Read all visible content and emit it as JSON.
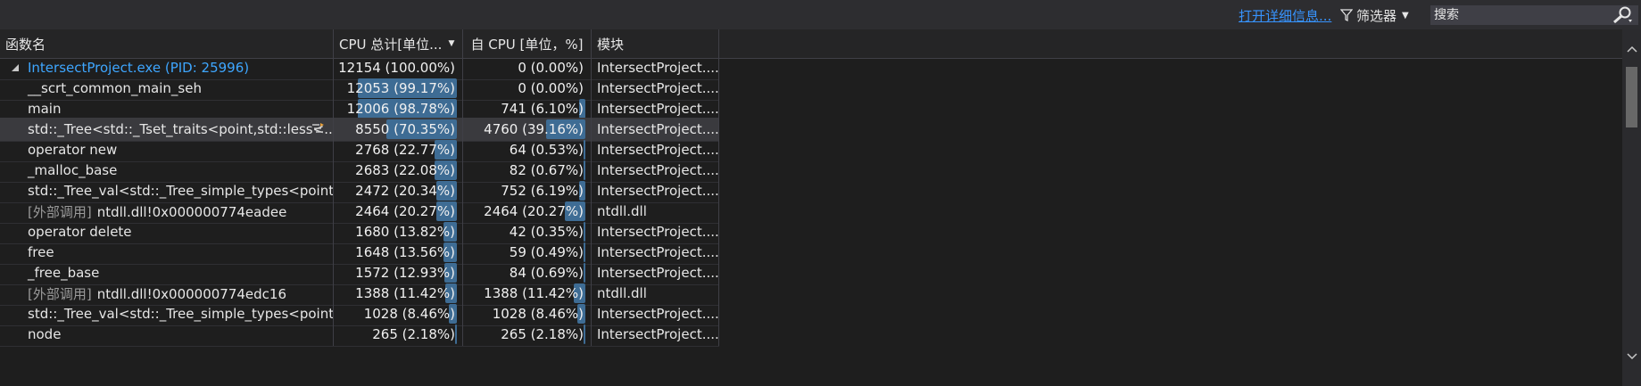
{
  "toolbar": {
    "details_link": "打开详细信息...",
    "filter_label": "筛选器",
    "search_placeholder": "搜索"
  },
  "columns": {
    "name": "函数名",
    "total_cpu": "CPU 总计[单位...",
    "self_cpu": "自 CPU [单位，%]",
    "module": "模块"
  },
  "rows": [
    {
      "name": "IntersectProject.exe (PID: 25996)",
      "root": true,
      "total": "12154 (100.00%)",
      "total_pct": 0,
      "self": "0 (0.00%)",
      "self_pct": 0,
      "module": "IntersectProject...."
    },
    {
      "name": "__scrt_common_main_seh",
      "total": "12053 (99.17%)",
      "total_pct": 99.17,
      "self": "0 (0.00%)",
      "self_pct": 0,
      "module": "IntersectProject...."
    },
    {
      "name": "main",
      "total": "12006 (98.78%)",
      "total_pct": 98.78,
      "self": "741 (6.10%)",
      "self_pct": 6.1,
      "module": "IntersectProject...."
    },
    {
      "name": "std::_Tree<std::_Tset_traits<point,std::less<...",
      "selected": true,
      "hot": true,
      "total": "8550 (70.35%)",
      "total_pct": 70.35,
      "self": "4760 (39.16%)",
      "self_pct": 39.16,
      "module": "IntersectProject...."
    },
    {
      "name": "operator new",
      "total": "2768 (22.77%)",
      "total_pct": 22.77,
      "self": "64 (0.53%)",
      "self_pct": 0.53,
      "module": "IntersectProject...."
    },
    {
      "name": "_malloc_base",
      "total": "2683 (22.08%)",
      "total_pct": 22.08,
      "self": "82 (0.67%)",
      "self_pct": 0.67,
      "module": "IntersectProject...."
    },
    {
      "name": "std::_Tree_val<std::_Tree_simple_types<point...",
      "total": "2472 (20.34%)",
      "total_pct": 20.34,
      "self": "752 (6.19%)",
      "self_pct": 6.19,
      "module": "IntersectProject...."
    },
    {
      "prefix": "[外部调用]",
      "name": "ntdll.dll!0x000000774eadee",
      "total": "2464 (20.27%)",
      "total_pct": 20.27,
      "self": "2464 (20.27%)",
      "self_pct": 20.27,
      "module": "ntdll.dll"
    },
    {
      "name": "operator delete",
      "total": "1680 (13.82%)",
      "total_pct": 13.82,
      "self": "42 (0.35%)",
      "self_pct": 0.35,
      "module": "IntersectProject...."
    },
    {
      "name": "free",
      "total": "1648 (13.56%)",
      "total_pct": 13.56,
      "self": "59 (0.49%)",
      "self_pct": 0.49,
      "module": "IntersectProject...."
    },
    {
      "name": "_free_base",
      "total": "1572 (12.93%)",
      "total_pct": 12.93,
      "self": "84 (0.69%)",
      "self_pct": 0.69,
      "module": "IntersectProject...."
    },
    {
      "prefix": "[外部调用]",
      "name": "ntdll.dll!0x000000774edc16",
      "total": "1388 (11.42%)",
      "total_pct": 11.42,
      "self": "1388 (11.42%)",
      "self_pct": 11.42,
      "module": "ntdll.dll"
    },
    {
      "name": "std::_Tree_val<std::_Tree_simple_types<point...",
      "total": "1028 (8.46%)",
      "total_pct": 8.46,
      "self": "1028 (8.46%)",
      "self_pct": 8.46,
      "module": "IntersectProject...."
    },
    {
      "name": "node",
      "total": "265 (2.18%)",
      "total_pct": 2.18,
      "self": "265 (2.18%)",
      "self_pct": 2.18,
      "module": "IntersectProject...."
    }
  ],
  "colors": {
    "bar": "#3e6c94",
    "link": "#3794ff",
    "root_name": "#3ea6ff"
  }
}
